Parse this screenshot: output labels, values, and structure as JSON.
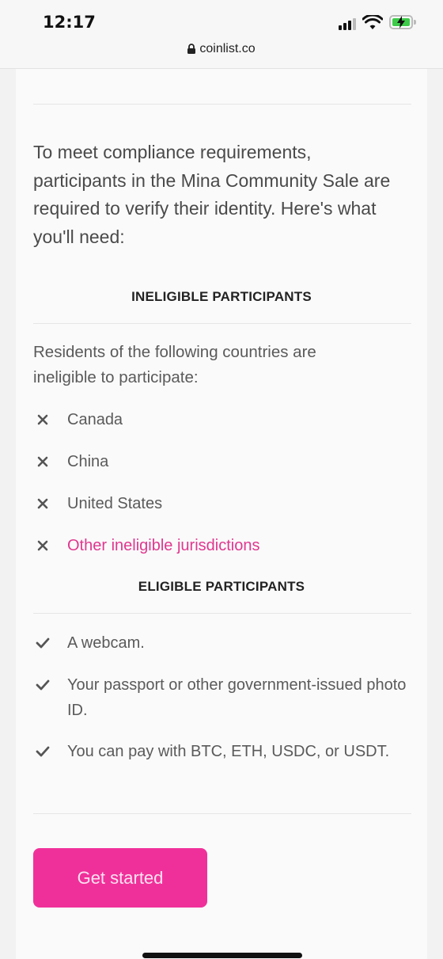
{
  "status_bar": {
    "time": "12:17"
  },
  "browser": {
    "url": "coinlist.co"
  },
  "intro": "To meet compliance requirements, participants in the Mina Community Sale are required to verify their identity. Here's what you'll need:",
  "ineligible": {
    "title": "INELIGIBLE PARTICIPANTS",
    "note": "Residents of the following countries are ineligible to participate:",
    "items": [
      "Canada",
      "China",
      "United States"
    ],
    "link": "Other ineligible jurisdictions"
  },
  "eligible": {
    "title": "ELIGIBLE PARTICIPANTS",
    "items": [
      "A webcam.",
      "Your passport or other government-issued photo ID.",
      "You can pay with BTC, ETH, USDC, or USDT."
    ]
  },
  "cta": {
    "label": "Get started"
  },
  "colors": {
    "accent": "#f0309a",
    "link": "#e0378f",
    "background": "#f2f2f2"
  },
  "icons": [
    "lock-icon",
    "signal-icon",
    "wifi-icon",
    "battery-icon",
    "cross-icon",
    "check-icon"
  ]
}
